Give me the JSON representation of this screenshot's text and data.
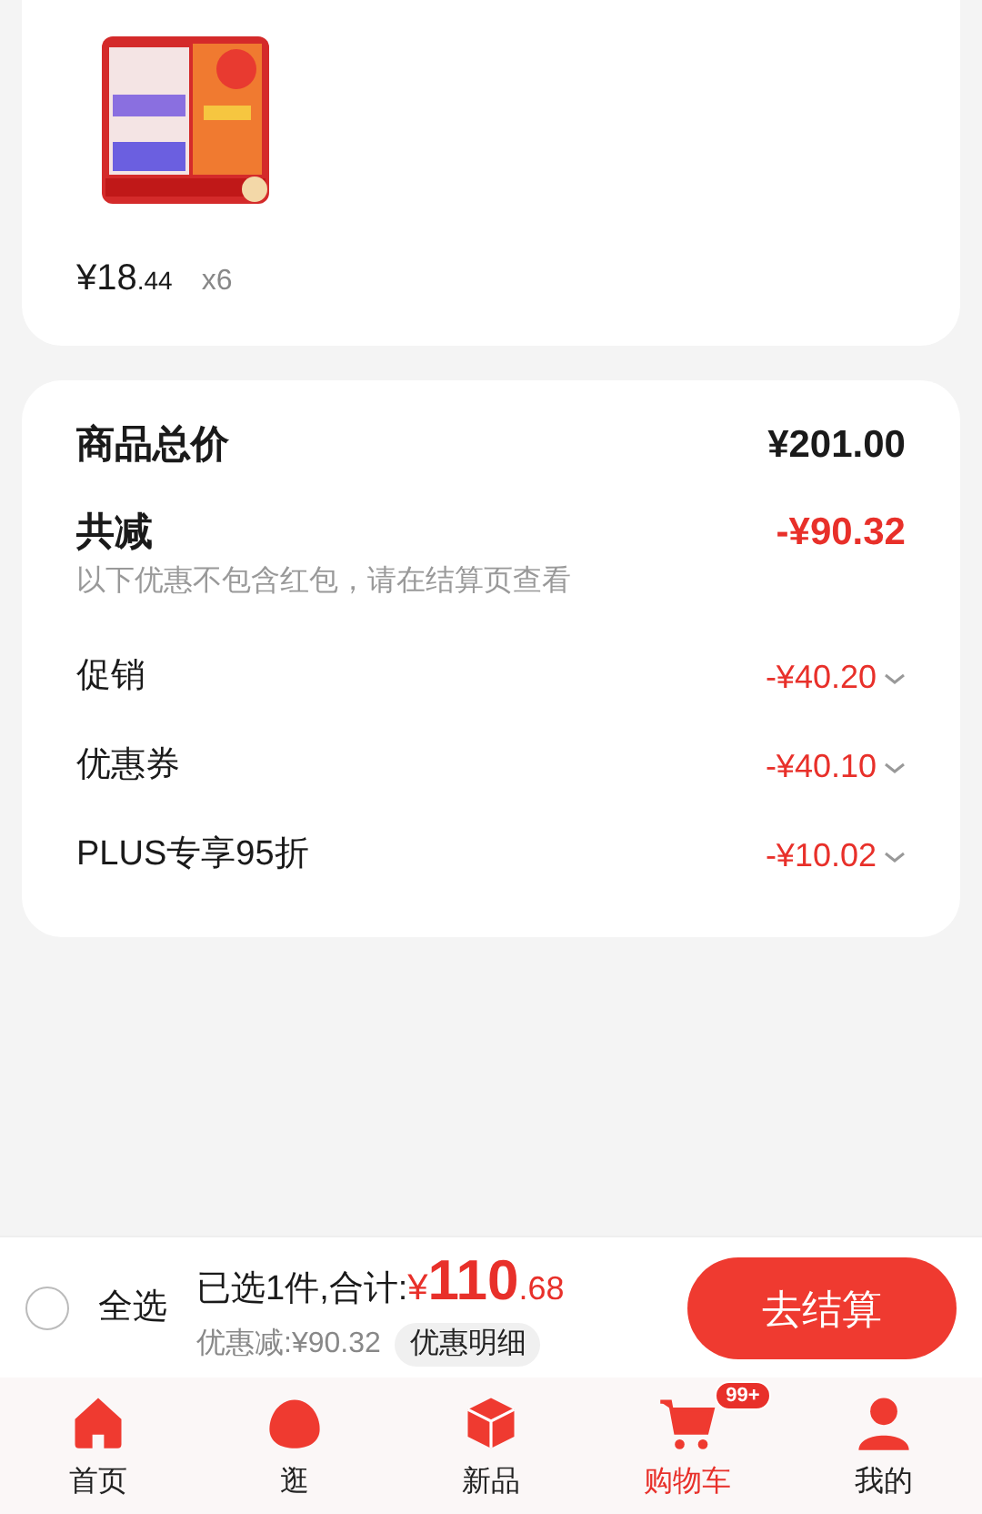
{
  "product": {
    "price_integer": "¥18",
    "price_decimal": ".44",
    "quantity": "x6"
  },
  "summary": {
    "total_label": "商品总价",
    "total_value": "¥201.00",
    "discount_label": "共减",
    "discount_value": "-¥90.32",
    "note": "以下优惠不包含红包，请在结算页查看",
    "items": [
      {
        "label": "促销",
        "value": "-¥40.20",
        "expanded": false
      },
      {
        "label": "优惠券",
        "value": "-¥40.10",
        "expanded": false
      },
      {
        "label": "PLUS专享95折",
        "value": "-¥10.02",
        "expanded": false
      }
    ]
  },
  "checkout": {
    "select_all": {
      "label": "全选",
      "checked": false
    },
    "selected_text": "已选1件,合计:",
    "currency": "¥",
    "total_integer": "110",
    "total_decimal": ".68",
    "saving": "优惠减:¥90.32",
    "details_button": "优惠明细",
    "checkout_button": "去结算"
  },
  "tabs": [
    {
      "label": "首页",
      "kind": "home",
      "selected": false
    },
    {
      "label": "逛",
      "kind": "blob",
      "selected": false
    },
    {
      "label": "新品",
      "kind": "cube",
      "selected": false
    },
    {
      "label": "购物车",
      "kind": "cart",
      "selected": true,
      "badge": "99+"
    },
    {
      "label": "我的",
      "kind": "person",
      "selected": false
    }
  ]
}
